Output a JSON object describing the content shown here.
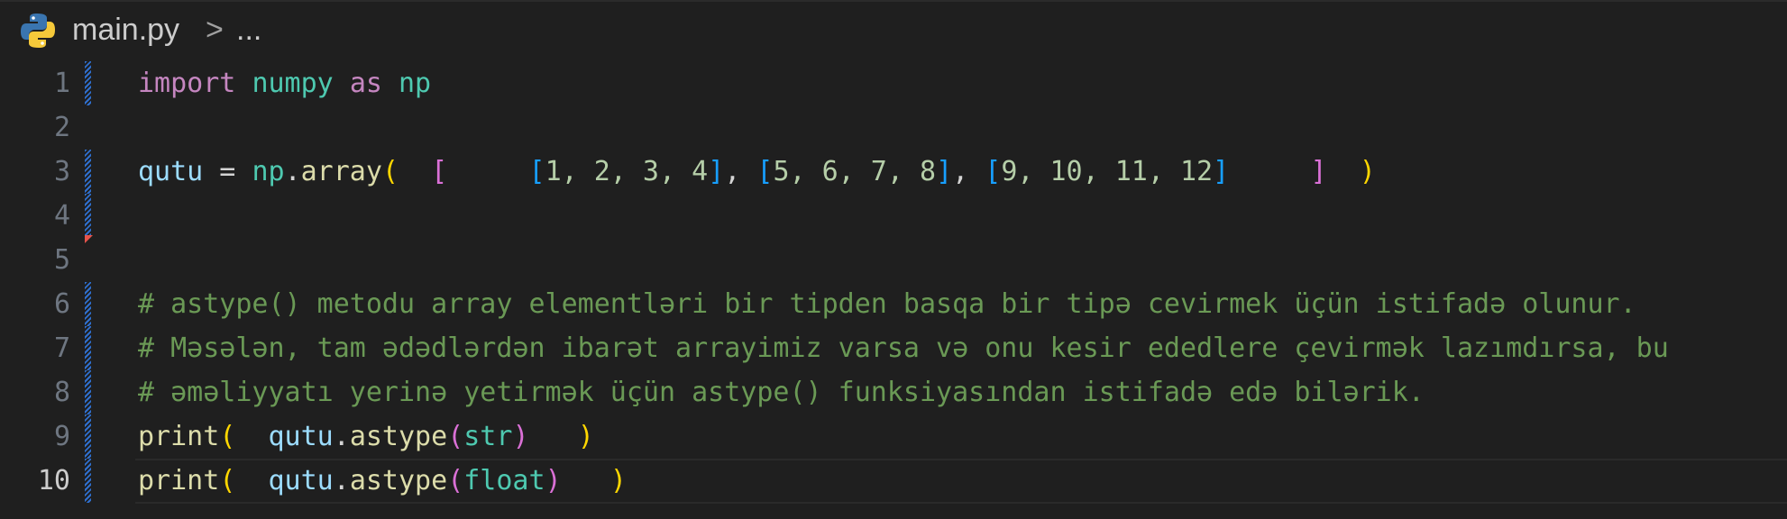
{
  "breadcrumb": {
    "icon": "python-icon",
    "file": "main.py",
    "separator": ">",
    "more": "..."
  },
  "editor": {
    "active_line": 10,
    "lines": [
      {
        "n": "1"
      },
      {
        "n": "2"
      },
      {
        "n": "3"
      },
      {
        "n": "4"
      },
      {
        "n": "5"
      },
      {
        "n": "6"
      },
      {
        "n": "7"
      },
      {
        "n": "8"
      },
      {
        "n": "9"
      },
      {
        "n": "10"
      }
    ],
    "tokens": {
      "l1": {
        "import": "import",
        "numpy": "numpy",
        "as": "as",
        "np": "np"
      },
      "l3": {
        "var": "qutu",
        "eq": " = ",
        "mod": "np",
        "dot": ".",
        "fn": "array",
        "p_open": "(",
        "sp1": "  ",
        "b_open": "[",
        "sp2": "     ",
        "a1_open": "[",
        "a1": "1, 2, 3, 4",
        "a1_close": "]",
        "c1": ", ",
        "a2_open": "[",
        "a2": "5, 6, 7, 8",
        "a2_close": "]",
        "c2": ", ",
        "a3_open": "[",
        "a3": "9, 10, 11, 12",
        "a3_close": "]",
        "sp3": "     ",
        "b_close": "]",
        "sp4": "  ",
        "p_close": ")"
      },
      "l6": "# astype() metodu array elementləri bir tipden basqa bir tipə cevirmek üçün istifadə olunur.",
      "l7": "# Məsələn, tam ədədlərdən ibarət arrayimiz varsa və onu kesir ededlere çevirmək lazımdırsa, bu",
      "l8": "# əməliyyatı yerinə yetirmək üçün astype() funksiyasından istifadə edə bilərik.",
      "l9": {
        "fn": "print",
        "p_open": "(",
        "sp1": "  ",
        "var": "qutu",
        "dot": ".",
        "method": "astype",
        "i_open": "(",
        "arg": "str",
        "i_close": ")",
        "sp2": "   ",
        "p_close": ")"
      },
      "l10": {
        "fn": "print",
        "p_open": "(",
        "sp1": "  ",
        "var": "qutu",
        "dot": ".",
        "method": "astype",
        "i_open": "(",
        "arg": "float",
        "i_close": ")",
        "sp2": "   ",
        "p_close": ")"
      }
    }
  }
}
